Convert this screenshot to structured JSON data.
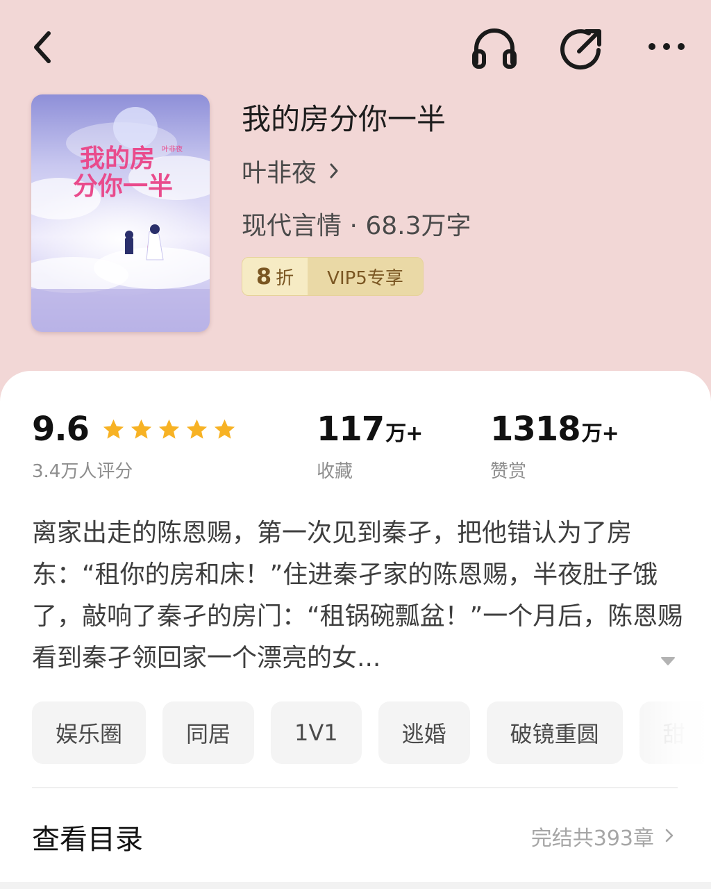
{
  "colors": {
    "header_bg": "#f2d7d6",
    "sheet_bg": "#ffffff",
    "star": "#f7b224",
    "badge_gold": "#ead9a6",
    "badge_text": "#7a5622"
  },
  "topbar": {
    "icons": [
      "back-chevron-icon",
      "headphones-icon",
      "share-icon",
      "more-dots-icon"
    ]
  },
  "book": {
    "cover": {
      "title_art": "我的房分你一半",
      "author_art": "叶非夜"
    },
    "title": "我的房分你一半",
    "author": "叶非夜",
    "meta": "现代言情 · 68.3万字",
    "discount": {
      "num": "8",
      "unit": "折"
    },
    "vip": "VIP5专享"
  },
  "stats": {
    "rating": {
      "value": "9.6",
      "stars": 5,
      "sub": "3.4万人评分"
    },
    "favorites": {
      "value": "117",
      "suffix": "万+",
      "sub": "收藏"
    },
    "rewards": {
      "value": "1318",
      "suffix": "万+",
      "sub": "赞赏"
    }
  },
  "description": "离家出走的陈恩赐，第一次见到秦孑，把他错认为了房东：“租你的房和床！”住进秦孑家的陈恩赐，半夜肚子饿了，敲响了秦孑的房门：“租锅碗瓢盆！”一个月后，陈恩赐看到秦孑领回家一个漂亮的女...",
  "tags": [
    "娱乐圈",
    "同居",
    "1V1",
    "逃婚",
    "破镜重圆",
    "甜"
  ],
  "toc": {
    "title": "查看目录",
    "status": "完结共393章"
  }
}
